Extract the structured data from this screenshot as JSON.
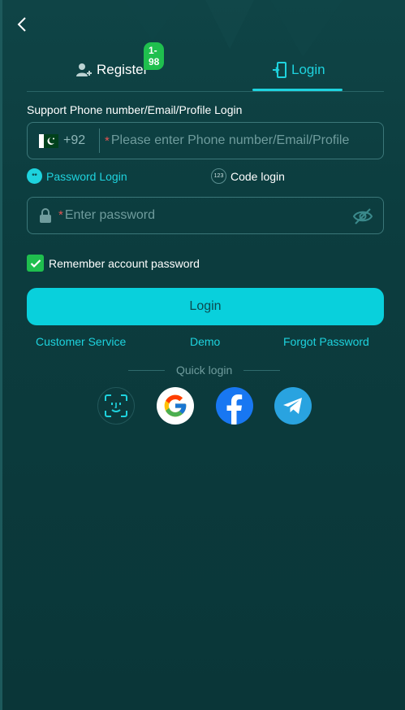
{
  "header": {
    "back_icon": "chevron-left-icon"
  },
  "tabs": {
    "register": {
      "label": "Register",
      "icon": "user-add-icon",
      "badge": "1-98"
    },
    "login": {
      "label": "Login",
      "icon": "door-enter-icon",
      "active": true
    }
  },
  "form": {
    "support_label": "Support Phone number/Email/Profile Login",
    "phone": {
      "country_flag": "pakistan-flag-icon",
      "country_code": "+92",
      "required_mark": "*",
      "placeholder": "Please enter Phone number/Email/Profile"
    },
    "modes": {
      "password": {
        "label": "Password Login",
        "icon_text": "**",
        "active": true
      },
      "code": {
        "label": "Code login",
        "icon_text": "123"
      }
    },
    "password": {
      "icon": "lock-icon",
      "required_mark": "*",
      "placeholder": "Enter password",
      "toggle_icon": "eye-off-icon"
    },
    "remember": {
      "label": "Remember account password",
      "checked": true
    },
    "submit_label": "Login"
  },
  "links": {
    "customer_service": "Customer Service",
    "demo": "Demo",
    "forgot_password": "Forgot Password"
  },
  "quick_login": {
    "label": "Quick login",
    "providers": [
      "face-id-icon",
      "google-icon",
      "facebook-icon",
      "telegram-icon"
    ]
  },
  "colors": {
    "background": "#0b3a3c",
    "accent": "#1ed3de",
    "button": "#09d0dc",
    "badge": "#1fbf4e",
    "required": "#e55353"
  }
}
